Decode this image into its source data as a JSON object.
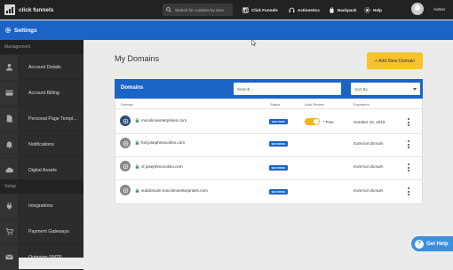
{
  "topbar": {
    "brand": "click funnels",
    "search_placeholder": "Search for contacts by ema",
    "nav": [
      {
        "label": "Click Funnels",
        "icon": "funnel-icon"
      },
      {
        "label": "Actionetics",
        "icon": "headset-icon"
      },
      {
        "label": "Backpack",
        "icon": "backpack-icon"
      },
      {
        "label": "Help",
        "icon": "help-icon"
      },
      {
        "label": "Admin",
        "icon": "avatar"
      }
    ]
  },
  "settings_bar": {
    "title": "Settings"
  },
  "sidebar": {
    "sections": [
      {
        "title": "Management",
        "items": [
          {
            "label": "Account Details",
            "icon": "user-icon"
          },
          {
            "label": "Account Billing",
            "icon": "card-icon"
          },
          {
            "label": "Personal Page Templ...",
            "icon": "page-icon"
          },
          {
            "label": "Notifications",
            "icon": "bell-icon"
          },
          {
            "label": "Digital Assets",
            "icon": "cloud-icon"
          }
        ]
      },
      {
        "title": "Setup",
        "items": [
          {
            "label": "Integrations",
            "icon": "plug-icon"
          },
          {
            "label": "Payment Gateways",
            "icon": "cart-icon"
          },
          {
            "label": "Outgoing SMTP",
            "icon": "mail-icon"
          }
        ]
      }
    ]
  },
  "main": {
    "title": "My Domains",
    "add_button": "+ Add New Domain",
    "panel": {
      "title": "Domains",
      "search_placeholder": "Search...",
      "sort_label": "Sort By",
      "columns": [
        "Domain",
        "Status",
        "Auto Renew",
        "Expiration"
      ],
      "rows": [
        {
          "domain": "mocolinoenterprises.com",
          "status": "SECURED",
          "auto_renew": true,
          "auto_renew_note": "* Free",
          "expiration": "October 10, 2018"
        },
        {
          "domain": "foil.josephmocolino.com",
          "status": "SECURING",
          "auto_renew": false,
          "auto_renew_note": "",
          "expiration": "External domain"
        },
        {
          "domain": "cf.josephmocolino.com",
          "status": "SECURING",
          "auto_renew": false,
          "auto_renew_note": "",
          "expiration": "External domain"
        },
        {
          "domain": "subdomain.mocolinoenterprises.com",
          "status": "SECURING",
          "auto_renew": false,
          "auto_renew_note": "",
          "expiration": "External domain"
        }
      ]
    }
  },
  "help_widget": {
    "label": "Get Help"
  },
  "colors": {
    "topbar": "#222222",
    "brand_blue": "#1c63c6",
    "accent_yellow": "#f6c32d",
    "sidebar": "#2c2c2c"
  }
}
